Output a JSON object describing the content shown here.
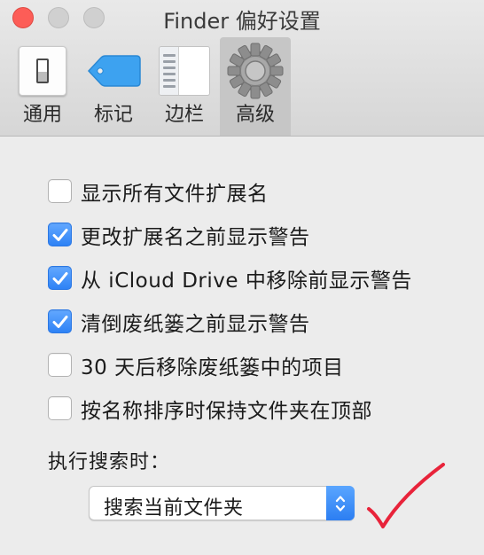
{
  "window": {
    "title": "Finder 偏好设置"
  },
  "tabs": [
    {
      "label": "通用",
      "icon": "switch-icon"
    },
    {
      "label": "标记",
      "icon": "tag-icon"
    },
    {
      "label": "边栏",
      "icon": "sidebar-icon"
    },
    {
      "label": "高级",
      "icon": "gear-icon",
      "selected": true
    }
  ],
  "options": [
    {
      "label": "显示所有文件扩展名",
      "checked": false
    },
    {
      "label": "更改扩展名之前显示警告",
      "checked": true
    },
    {
      "label": "从 iCloud Drive 中移除前显示警告",
      "checked": true
    },
    {
      "label": "清倒废纸篓之前显示警告",
      "checked": true
    },
    {
      "label": "30 天后移除废纸篓中的项目",
      "checked": false
    },
    {
      "label": "按名称排序时保持文件夹在顶部",
      "checked": false
    }
  ],
  "search": {
    "label": "执行搜索时：",
    "selected_value": "搜索当前文件夹"
  },
  "colors": {
    "accent": "#2e82f5",
    "close_button": "#fd5d57",
    "tag": "#3da2f0",
    "annotation": "#e8233a"
  }
}
